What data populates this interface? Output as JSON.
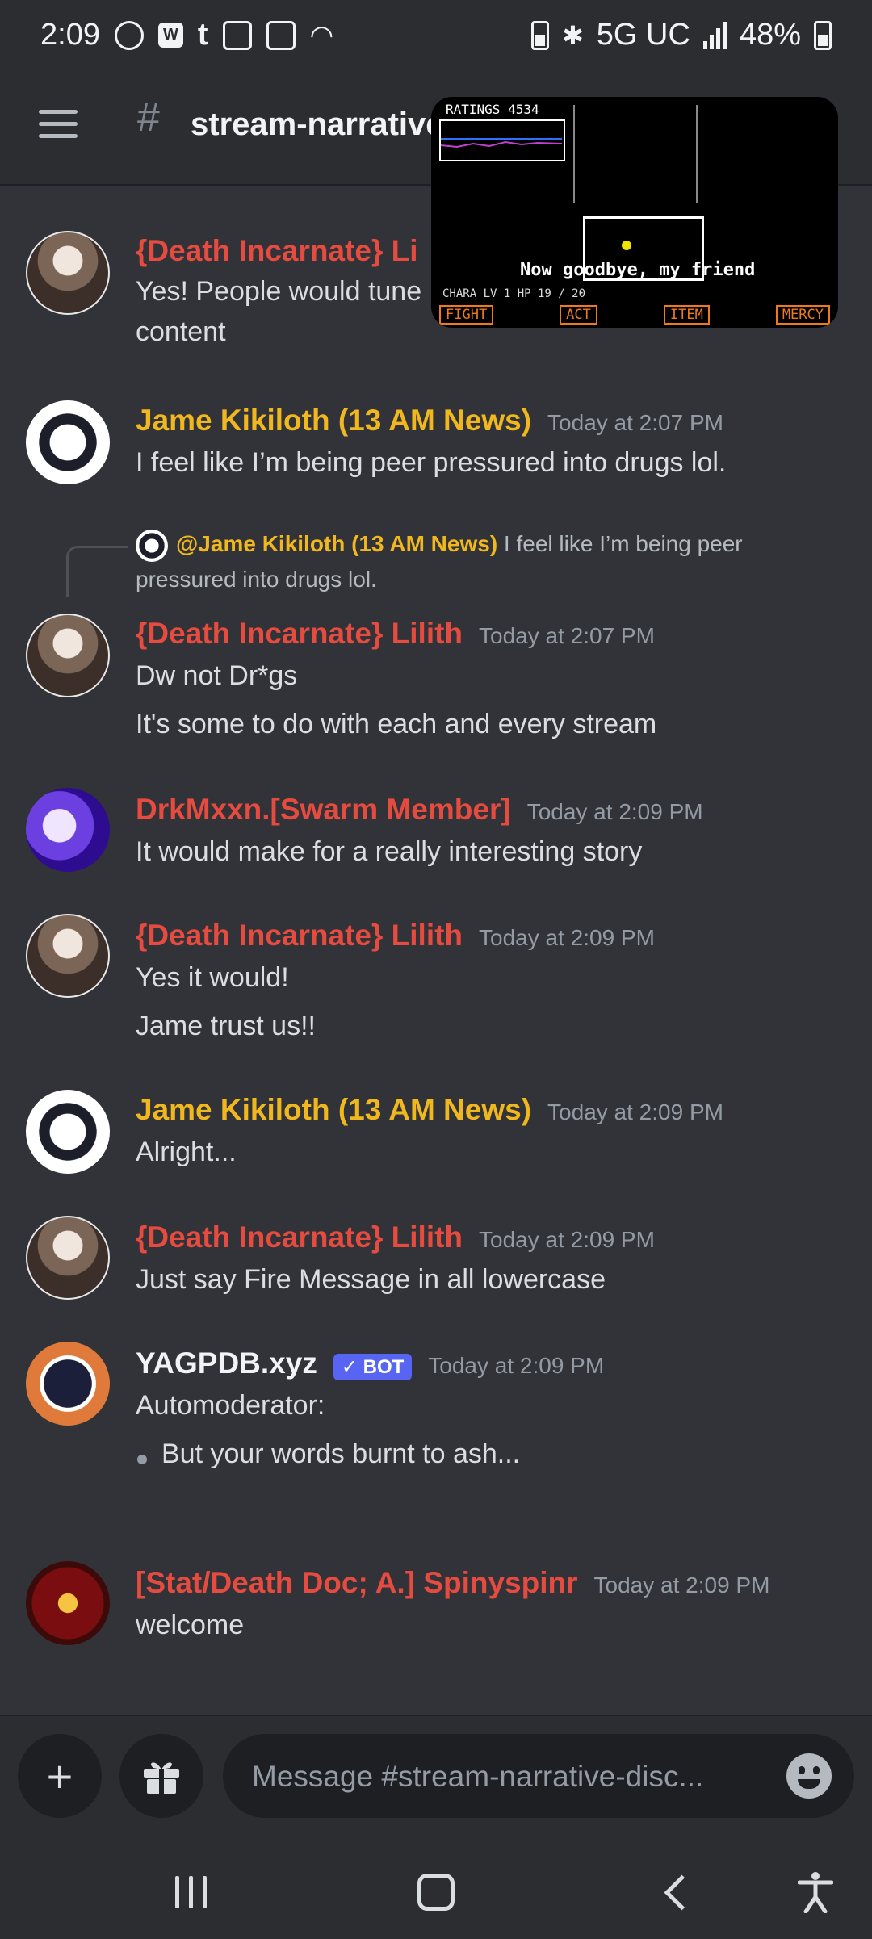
{
  "status_bar": {
    "time": "2:09",
    "network": "5G UC",
    "battery": "48%",
    "icons": [
      "do-not-disturb-icon",
      "webtoon-icon",
      "tumblr-icon",
      "twitch-icon",
      "gallery-icon",
      "wifi-icon",
      "battery-saver-icon",
      "bluetooth-icon",
      "signal-icon",
      "battery-icon"
    ]
  },
  "header": {
    "hash": "#",
    "channel": "stream-narrative",
    "menu_icon": "hamburger-icon"
  },
  "pip": {
    "ratings": "RATINGS 4534",
    "caption": "Now goodbye, my friend",
    "stats": "CHARA   LV 1      HP      19 / 20",
    "menu": [
      "FIGHT",
      "ACT",
      "ITEM",
      "MERCY"
    ]
  },
  "messages": [
    {
      "author": "{Death Incarnate} Li",
      "lines": [
        "Yes! People would tune",
        "content"
      ]
    },
    {
      "author": "Jame Kikiloth (13 AM News)",
      "timestamp": "Today at 2:07 PM",
      "lines": [
        "I feel like I’m being peer pressured into drugs lol."
      ]
    },
    {
      "reply_author": "@Jame Kikiloth (13 AM News)",
      "reply_text_1": "I feel like I’m being peer",
      "reply_text_2": "pressured into drugs lol.",
      "author": "{Death Incarnate} Lilith",
      "timestamp": "Today at 2:07 PM",
      "lines": [
        "Dw not Dr*gs",
        "It's some to do with each and every stream"
      ]
    },
    {
      "author": "DrkMxxn.[Swarm Member]",
      "timestamp": "Today at 2:09 PM",
      "lines": [
        "It would make for a really interesting story"
      ]
    },
    {
      "author": "{Death Incarnate} Lilith",
      "timestamp": "Today at 2:09 PM",
      "lines": [
        "Yes it would!",
        "Jame trust us!!"
      ]
    },
    {
      "author": "Jame Kikiloth (13 AM News)",
      "timestamp": "Today at 2:09 PM",
      "lines": [
        "Alright..."
      ]
    },
    {
      "author": "{Death Incarnate} Lilith",
      "timestamp": "Today at 2:09 PM",
      "lines": [
        "Just say Fire Message in all lowercase"
      ]
    },
    {
      "author": "YAGPDB.xyz",
      "badge": "✓ BOT",
      "timestamp": "Today at 2:09 PM",
      "lines": [
        "Automoderator:",
        "But your words burnt to ash..."
      ]
    },
    {
      "author": "[Stat/Death Doc; A.] Spinyspinr",
      "timestamp": "Today at 2:09 PM",
      "lines": [
        "welcome"
      ]
    }
  ],
  "composer": {
    "placeholder": "Message #stream-narrative-disc...",
    "plus": "+",
    "gift_icon": "gift-icon",
    "emoji_icon": "emoji-icon"
  },
  "colors": {
    "background": "#313338",
    "header": "#2b2d31",
    "author_red": "#e54b3f",
    "author_gold": "#f0b81e",
    "bot_badge": "#5865f2",
    "timestamp": "#949ba4"
  }
}
